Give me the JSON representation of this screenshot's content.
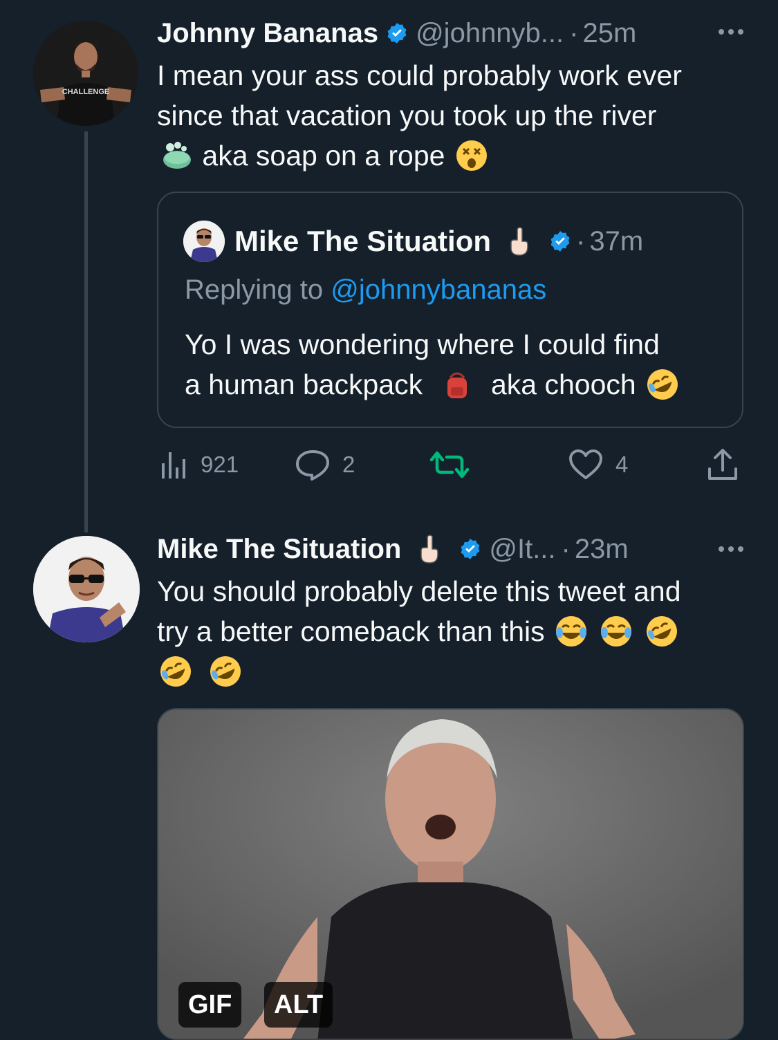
{
  "tweet1": {
    "name": "Johnny Bananas",
    "handle": "@johnnyb...",
    "separator": "·",
    "time": "25m",
    "avatar_shirt_text": "CHALLENGE",
    "lines": [
      "I mean your ass could probably work ever",
      "since that vacation you took up the river",
      "aka soap on a rope"
    ],
    "emojis": [
      "soap-emoji",
      "dizzy-face-emoji"
    ],
    "quote": {
      "name": "Mike The Situation",
      "separator": "·",
      "time": "37m",
      "replying_prefix": "Replying to ",
      "replying_handle": "@johnnybananas",
      "line1": "Yo I was wondering where I could find",
      "line2_a": "a human backpack",
      "line2_b": "aka chooch",
      "emojis": [
        "index-pointing-up-emoji",
        "backpack-emoji",
        "rolling-on-floor-laughing-emoji"
      ]
    },
    "actions": {
      "views": "921",
      "replies": "2",
      "retweets": "",
      "likes": "4"
    }
  },
  "tweet2": {
    "name": "Mike The Situation",
    "handle": "@It...",
    "separator": "·",
    "time": "23m",
    "line1": "You should probably delete this tweet and",
    "line2": "try a better comeback than this",
    "emojis": [
      "face-with-tears-of-joy-emoji",
      "face-with-tears-of-joy-emoji",
      "rolling-on-floor-laughing-emoji",
      "rolling-on-floor-laughing-emoji",
      "rolling-on-floor-laughing-emoji"
    ],
    "media": {
      "gif_label": "GIF",
      "alt_label": "ALT"
    }
  },
  "colors": {
    "background": "#15202b",
    "text": "#f7f9f9",
    "secondary": "#8b98a5",
    "accent": "#1d9bf0",
    "retweet": "#00ba7c",
    "border": "#38444d"
  }
}
